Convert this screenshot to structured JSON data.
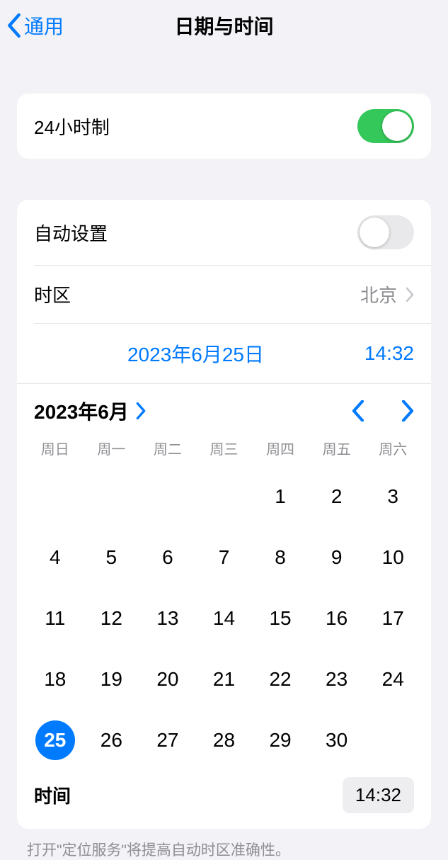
{
  "header": {
    "back_label": "通用",
    "title": "日期与时间"
  },
  "twenty_four": {
    "label": "24小时制",
    "enabled": true
  },
  "auto_set": {
    "label": "自动设置",
    "enabled": false
  },
  "timezone": {
    "label": "时区",
    "value": "北京"
  },
  "summary": {
    "date": "2023年6月25日",
    "time": "14:32"
  },
  "calendar": {
    "month_label": "2023年6月",
    "weekdays": [
      "周日",
      "周一",
      "周二",
      "周三",
      "周四",
      "周五",
      "周六"
    ],
    "leading_blanks": 4,
    "days_in_month": 30,
    "selected_day": 25
  },
  "time_row": {
    "label": "时间",
    "value": "14:32"
  },
  "footer": {
    "note": "打开\"定位服务\"将提高自动时区准确性。"
  }
}
